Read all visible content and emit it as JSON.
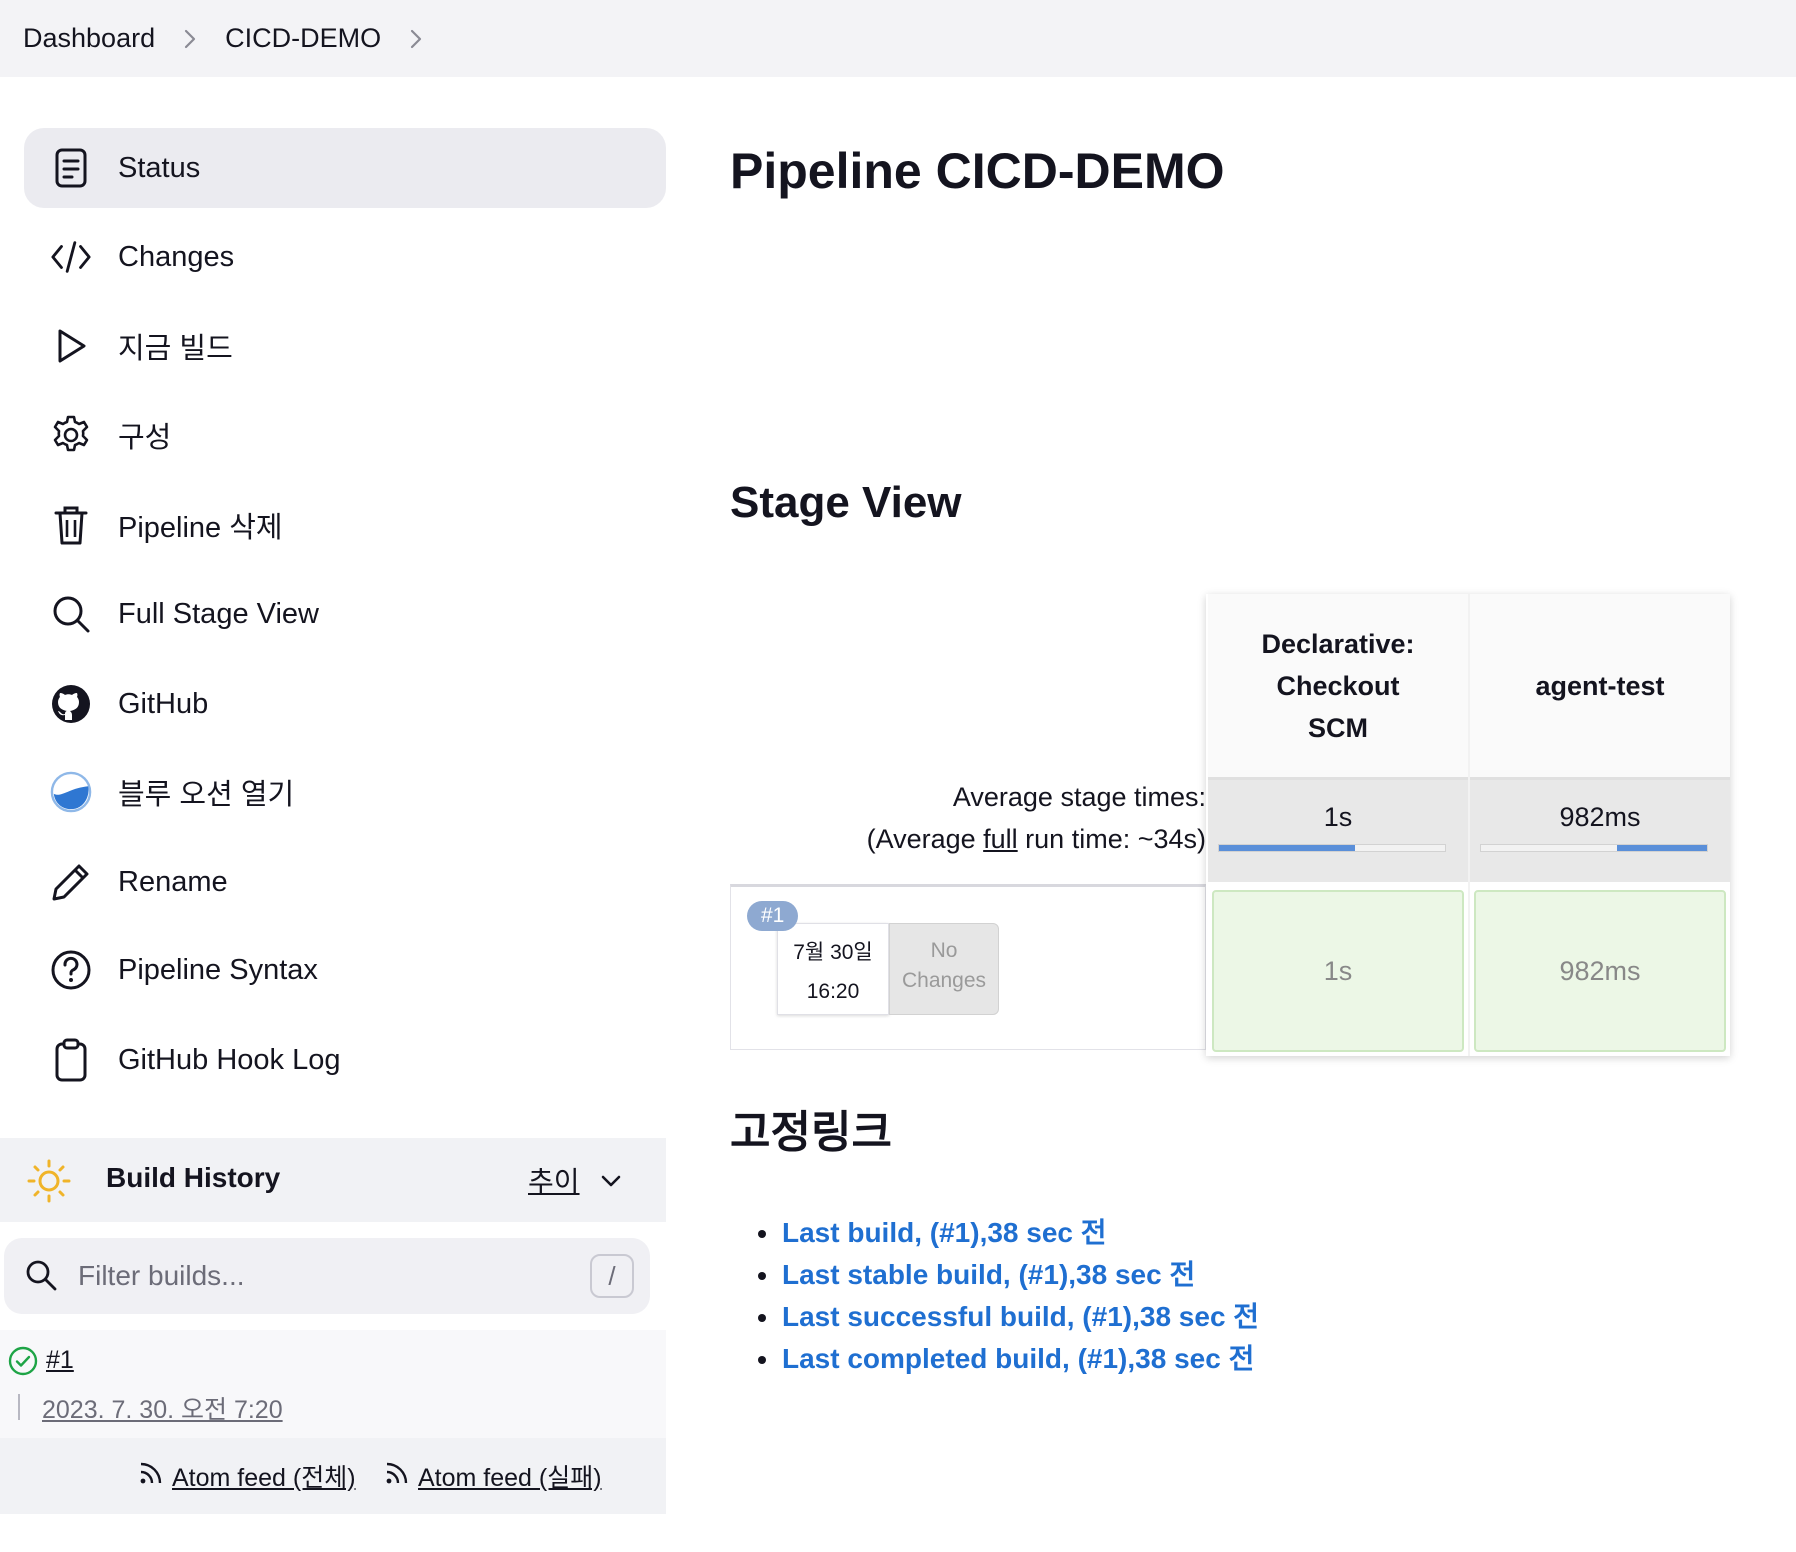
{
  "breadcrumb": {
    "items": [
      "Dashboard",
      "CICD-DEMO"
    ]
  },
  "sidebar": {
    "items": [
      {
        "label": "Status",
        "icon": "status-document-icon",
        "active": true
      },
      {
        "label": "Changes",
        "icon": "code-brackets-icon"
      },
      {
        "label": "지금 빌드",
        "icon": "play-icon"
      },
      {
        "label": "구성",
        "icon": "gear-icon"
      },
      {
        "label": "Pipeline 삭제",
        "icon": "trash-icon"
      },
      {
        "label": "Full Stage View",
        "icon": "search-icon"
      },
      {
        "label": "GitHub",
        "icon": "github-icon"
      },
      {
        "label": "블루 오션 열기",
        "icon": "blue-ocean-icon"
      },
      {
        "label": "Rename",
        "icon": "pencil-icon"
      },
      {
        "label": "Pipeline Syntax",
        "icon": "help-circle-icon"
      },
      {
        "label": "GitHub Hook Log",
        "icon": "clipboard-icon"
      }
    ]
  },
  "build_history": {
    "title": "Build History",
    "trend_label": "추이",
    "filter_placeholder": "Filter builds...",
    "filter_shortcut": "/",
    "builds": [
      {
        "number": "#1",
        "date": "2023. 7. 30. 오전 7:20",
        "status": "success"
      }
    ],
    "feeds": [
      "Atom feed (전체)",
      "Atom feed (실패)"
    ]
  },
  "main": {
    "title": "Pipeline CICD-DEMO",
    "stage_view_title": "Stage View",
    "avg_stage_label": "Average stage times:",
    "avg_run_prefix": "(Average ",
    "avg_run_link": "full",
    "avg_run_suffix": " run time: ~34s)",
    "stages": [
      {
        "name": "Declarative: Checkout SCM",
        "avg": "1s",
        "avg_fraction": 0.6,
        "avg_align": "left"
      },
      {
        "name": "agent-test",
        "avg": "982ms",
        "avg_fraction": 0.4,
        "avg_align": "right"
      }
    ],
    "runs": [
      {
        "badge": "#1",
        "date": "7월 30일",
        "time": "16:20",
        "changes": "No Changes",
        "stage_times": [
          "1s",
          "982ms"
        ]
      }
    ],
    "permalinks_title": "고정링크",
    "permalinks": [
      "Last build, (#1),38 sec 전",
      "Last stable build, (#1),38 sec 전",
      "Last successful build, (#1),38 sec 전",
      "Last completed build, (#1),38 sec 전"
    ]
  },
  "colors": {
    "link": "#1f6fd1",
    "stage_success_bg": "#ecf7e6",
    "bar_fill": "#5a8fd9",
    "run_badge": "#8ea9d1"
  }
}
